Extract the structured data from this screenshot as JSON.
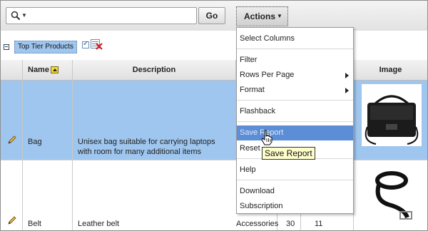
{
  "toolbar": {
    "search_icon": "magnifier-icon",
    "search_value": "",
    "search_placeholder": "",
    "go_label": "Go",
    "actions_label": "Actions"
  },
  "filter": {
    "saved_report_label": "Top Tier Products",
    "checkbox_checked": true
  },
  "table": {
    "columns": [
      "Name",
      "Description",
      "Image"
    ],
    "rows": [
      {
        "name": "Bag",
        "description": "Unisex bag suitable for carrying laptops with room for many additional items",
        "selected": true,
        "image": "bag-image"
      },
      {
        "name": "Belt",
        "description": "Leather belt",
        "category": "Accessories",
        "qty": "30",
        "other": "11",
        "selected": false,
        "image": "belt-image"
      }
    ]
  },
  "menu": {
    "items": [
      {
        "label": "Select Columns"
      },
      {
        "label": "Filter"
      },
      {
        "label": "Rows Per Page",
        "submenu": true
      },
      {
        "label": "Format",
        "submenu": true
      },
      {
        "label": "Flashback"
      },
      {
        "label": "Save Report",
        "active": true
      },
      {
        "label": "Reset"
      },
      {
        "label": "Help"
      },
      {
        "label": "Download"
      },
      {
        "label": "Subscription"
      }
    ]
  },
  "tooltip": "Save Report",
  "colors": {
    "selected_row": "#9ec6ef",
    "menu_highlight": "#5b8ed6",
    "tooltip_bg": "#ffffcc"
  }
}
